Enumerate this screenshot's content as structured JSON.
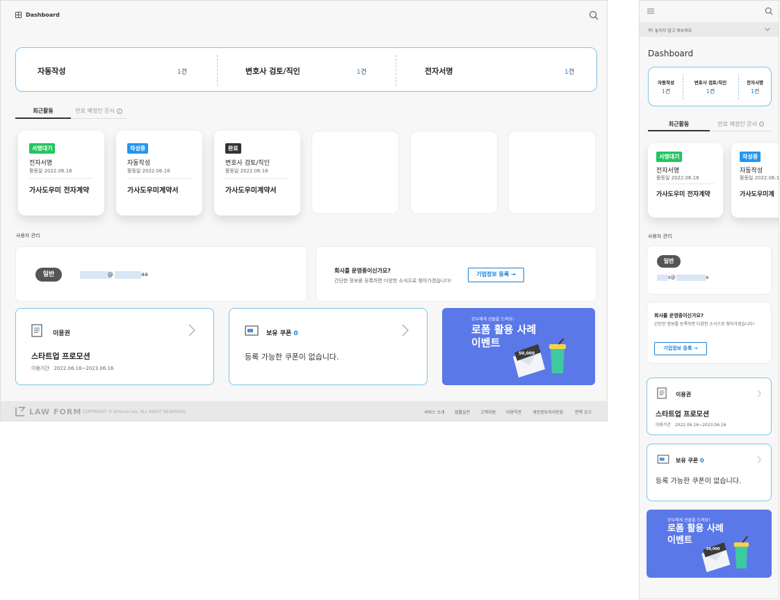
{
  "desktop": {
    "header": {
      "title": "Dashboard"
    },
    "stats": [
      {
        "label": "자동작성",
        "count": "1",
        "unit": "건"
      },
      {
        "label": "변호사 검토/직인",
        "count": "1",
        "unit": "건"
      },
      {
        "label": "전자서명",
        "count": "1",
        "unit": "건"
      }
    ],
    "tabs": {
      "recent": "최근활동",
      "expiring": "만료 예정인 문서"
    },
    "recent_cards": [
      {
        "badge": "서명대기",
        "badge_color": "#22c55e",
        "type": "전자서명",
        "date_label": "활동일",
        "date": "2022.06.16",
        "name": "가사도우미 전자계약"
      },
      {
        "badge": "작성중",
        "badge_color": "#2196f3",
        "type": "자동작성",
        "date_label": "활동일",
        "date": "2022.06.16",
        "name": "가사도우미계약서"
      },
      {
        "badge": "완료",
        "badge_color": "#333333",
        "type": "변호사 검토/직인",
        "date_label": "활동일",
        "date": "2022.06.16",
        "name": "가사도우미계약서"
      }
    ],
    "user_section": {
      "label": "사용자 관리",
      "role": "일반",
      "email_at": "@",
      "email_tail": "aa",
      "company_q": "회사를 운영중이신가요?",
      "company_desc": "간단한 정보를 등록하면 다양한 소식으로 찾아가겠습니다!",
      "company_btn": "기업정보 등록 →"
    },
    "license": {
      "label": "이용권",
      "plan": "스타트업 프로모션",
      "period_label": "이용기간",
      "period": "2022.06.16~2023.06.16"
    },
    "coupon": {
      "label": "보유 쿠폰",
      "count": "0",
      "empty_msg": "등록 가능한 쿠폰이 없습니다."
    },
    "event": {
      "sub": "모두에게 선물을 드려요!",
      "title_line1": "로폼 활용 사례",
      "title_line2": "이벤트",
      "ticket": "50,000"
    },
    "footer": {
      "logo": "LAW FORM",
      "copyright": "COPYRIGHT © Amicus Lex. ALL RIGHT RESERVED.",
      "links": [
        "서비스 소개",
        "법률실전",
        "고객지원",
        "이용약관",
        "개인정보처리방침",
        "면책 공고"
      ]
    }
  },
  "mobile": {
    "notice": "꼭! 놓치지 말고 봐보세요",
    "title": "Dashboard",
    "stats": [
      {
        "label": "자동작성",
        "count": "1",
        "unit": "건"
      },
      {
        "label": "변호사 검토/직인",
        "count": "1",
        "unit": "건"
      },
      {
        "label": "전자서명",
        "count": "1",
        "unit": "건"
      }
    ],
    "tabs": {
      "recent": "최근활동",
      "expiring": "만료 예정인 문서"
    },
    "cards": [
      {
        "badge": "서명대기",
        "badge_color": "#22c55e",
        "type": "전자서명",
        "date_label": "활동일",
        "date": "2022.06.16",
        "name": "가사도우미 전자계약"
      },
      {
        "badge": "작성중",
        "badge_color": "#2196f3",
        "type": "자동작성",
        "date_label": "활동일",
        "date": "2022.06.1",
        "name": "가사도우미계"
      }
    ],
    "user_label": "사용자 관리",
    "role": "일반",
    "email_at": "s@",
    "email_tail": "a",
    "company_q": "회사를 운영중이신가요?",
    "company_desc": "간단한 정보를 등록하면 다양한 소식으로 찾아가겠습니다!",
    "company_btn": "기업정보 등록 →",
    "license": {
      "label": "이용권",
      "plan": "스타트업 프로모션",
      "period_label": "이용기간",
      "period": "2022.06.16~2023.06.16"
    },
    "coupon": {
      "label": "보유 쿠폰",
      "count": "0",
      "empty_msg": "등록 가능한 쿠폰이 없습니다."
    },
    "event": {
      "sub": "모두에게 선물을 드려요!",
      "title_line1": "로폼 활용 사례",
      "title_line2": "이벤트",
      "ticket": "50,000"
    }
  },
  "colors": {
    "accent": "#1a7fd4",
    "border_blue": "#7ec3e6",
    "event_bg": "#5b78e8"
  }
}
